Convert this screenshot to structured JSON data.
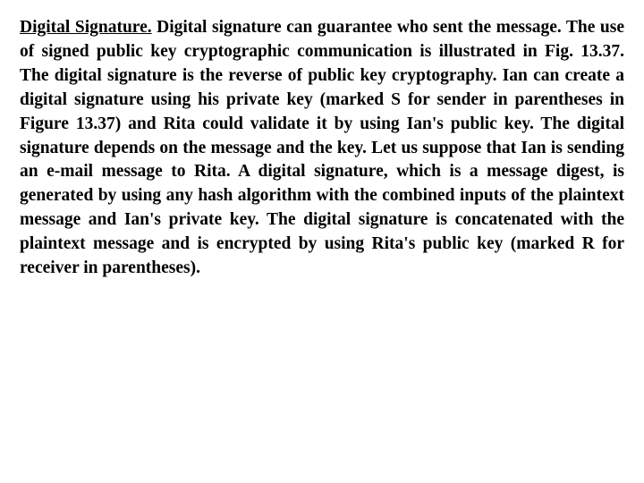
{
  "content": {
    "paragraph": {
      "title_underlined": "Digital Signature.",
      "body": "  Digital signature can guarantee who sent the message. The use of signed public key cryptographic communication is illustrated in Fig. 13.37.  The digital signature is the reverse of public key cryptography. Ian can create a digital signature using his private key (marked S for sender in parentheses in Figure 13.37) and Rita could validate it by using Ian's public key. The digital signature depends on the message and the key. Let us suppose that Ian is sending an e-mail message to Rita. A digital signature, which is a message digest, is generated by using any hash algorithm with the combined inputs of the plaintext message and Ian's private key. The digital signature is concatenated with the plaintext message and is encrypted by using Rita's public key (marked R for receiver in parentheses)."
    }
  }
}
